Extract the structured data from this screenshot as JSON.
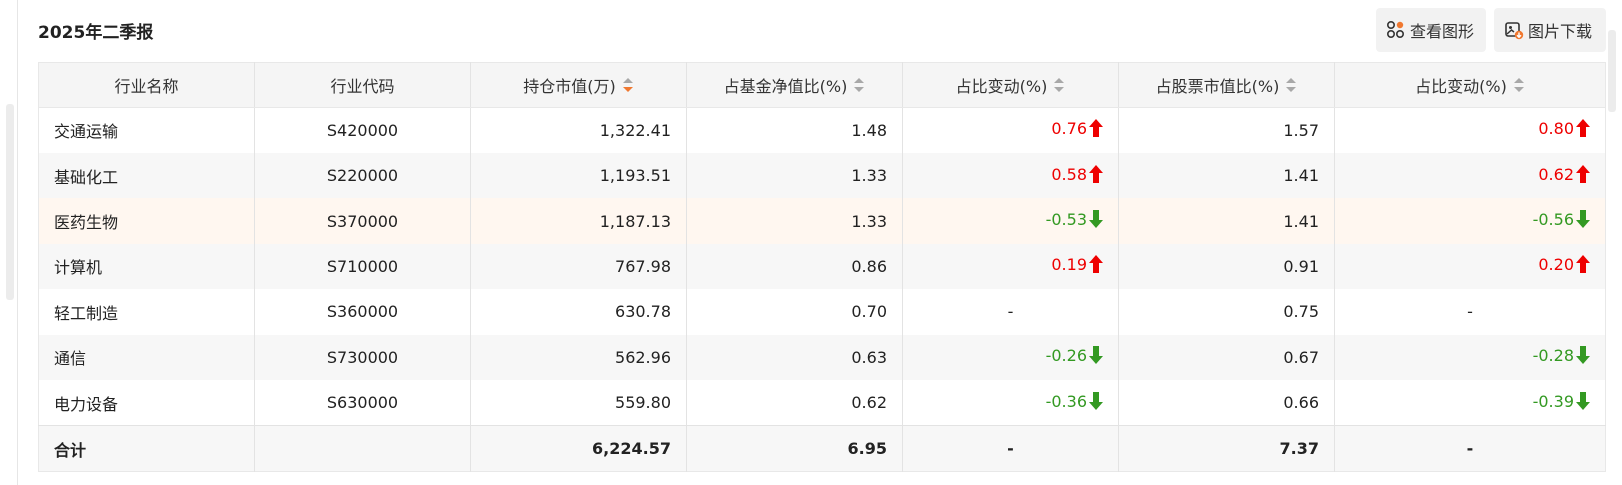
{
  "report": {
    "title": "2025年二季报"
  },
  "toolbar": {
    "view_chart": "查看图形",
    "download_image": "图片下载"
  },
  "colors": {
    "up": "#ee0000",
    "down": "#339922",
    "sort_active": "#f07830",
    "sort_inactive": "#a8a8a8"
  },
  "table": {
    "headers": [
      "行业名称",
      "行业代码",
      "持仓市值(万)",
      "占基金净值比(%)",
      "占比变动(%)",
      "占股票市值比(%)",
      "占比变动(%)"
    ],
    "rows": [
      {
        "name": "交通运输",
        "code": "S420000",
        "market_value": "1,322.41",
        "nav_ratio": "1.48",
        "nav_change": "0.76",
        "nav_dir": "up",
        "stock_ratio": "1.57",
        "stock_change": "0.80",
        "stock_dir": "up"
      },
      {
        "name": "基础化工",
        "code": "S220000",
        "market_value": "1,193.51",
        "nav_ratio": "1.33",
        "nav_change": "0.58",
        "nav_dir": "up",
        "stock_ratio": "1.41",
        "stock_change": "0.62",
        "stock_dir": "up"
      },
      {
        "name": "医药生物",
        "code": "S370000",
        "market_value": "1,187.13",
        "nav_ratio": "1.33",
        "nav_change": "-0.53",
        "nav_dir": "down",
        "stock_ratio": "1.41",
        "stock_change": "-0.56",
        "stock_dir": "down"
      },
      {
        "name": "计算机",
        "code": "S710000",
        "market_value": "767.98",
        "nav_ratio": "0.86",
        "nav_change": "0.19",
        "nav_dir": "up",
        "stock_ratio": "0.91",
        "stock_change": "0.20",
        "stock_dir": "up"
      },
      {
        "name": "轻工制造",
        "code": "S360000",
        "market_value": "630.78",
        "nav_ratio": "0.70",
        "nav_change": "-",
        "nav_dir": "none",
        "stock_ratio": "0.75",
        "stock_change": "-",
        "stock_dir": "none"
      },
      {
        "name": "通信",
        "code": "S730000",
        "market_value": "562.96",
        "nav_ratio": "0.63",
        "nav_change": "-0.26",
        "nav_dir": "down",
        "stock_ratio": "0.67",
        "stock_change": "-0.28",
        "stock_dir": "down"
      },
      {
        "name": "电力设备",
        "code": "S630000",
        "market_value": "559.80",
        "nav_ratio": "0.62",
        "nav_change": "-0.36",
        "nav_dir": "down",
        "stock_ratio": "0.66",
        "stock_change": "-0.39",
        "stock_dir": "down"
      }
    ],
    "total": {
      "label": "合计",
      "code": "",
      "market_value": "6,224.57",
      "nav_ratio": "6.95",
      "nav_change": "-",
      "stock_ratio": "7.37",
      "stock_change": "-"
    }
  }
}
